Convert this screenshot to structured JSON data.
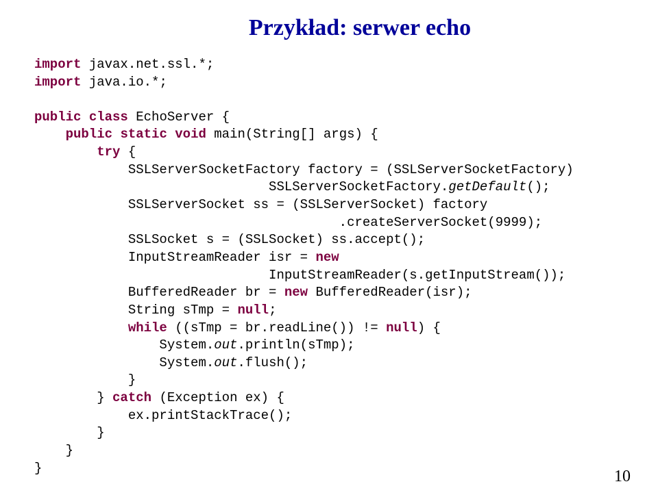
{
  "title": "Przykład: serwer echo",
  "pageNumber": "10",
  "code": {
    "l1a": "import",
    "l1b": " javax.net.ssl.*;",
    "l2a": "import",
    "l2b": " java.io.*;",
    "l3a": "public",
    "l3b": " ",
    "l3c": "class",
    "l3d": " EchoServer {",
    "l4a": "    ",
    "l4b": "public",
    "l4c": " ",
    "l4d": "static",
    "l4e": " ",
    "l4f": "void",
    "l4g": " main(String[] args) {",
    "l5a": "        ",
    "l5b": "try",
    "l5c": " {",
    "l6": "            SSLServerSocketFactory factory = (SSLServerSocketFactory)",
    "l7a": "                              SSLServerSocketFactory.",
    "l7b": "getDefault",
    "l7c": "();",
    "l8": "            SSLServerSocket ss = (SSLServerSocket) factory",
    "l9": "                                       .createServerSocket(9999);",
    "l10": "            SSLSocket s = (SSLSocket) ss.accept();",
    "l11a": "            InputStreamReader isr = ",
    "l11b": "new",
    "l12": "                              InputStreamReader(s.getInputStream());",
    "l13a": "            BufferedReader br = ",
    "l13b": "new",
    "l13c": " BufferedReader(isr);",
    "l14a": "            String sTmp = ",
    "l14b": "null",
    "l14c": ";",
    "l15a": "            ",
    "l15b": "while",
    "l15c": " ((sTmp = br.readLine()) != ",
    "l15d": "null",
    "l15e": ") {",
    "l16a": "                System.",
    "l16b": "out",
    "l16c": ".println(sTmp);",
    "l17a": "                System.",
    "l17b": "out",
    "l17c": ".flush();",
    "l18": "            }",
    "l19a": "        } ",
    "l19b": "catch",
    "l19c": " (Exception ex) {",
    "l20": "            ex.printStackTrace();",
    "l21": "        }",
    "l22": "    }",
    "l23": "}"
  }
}
